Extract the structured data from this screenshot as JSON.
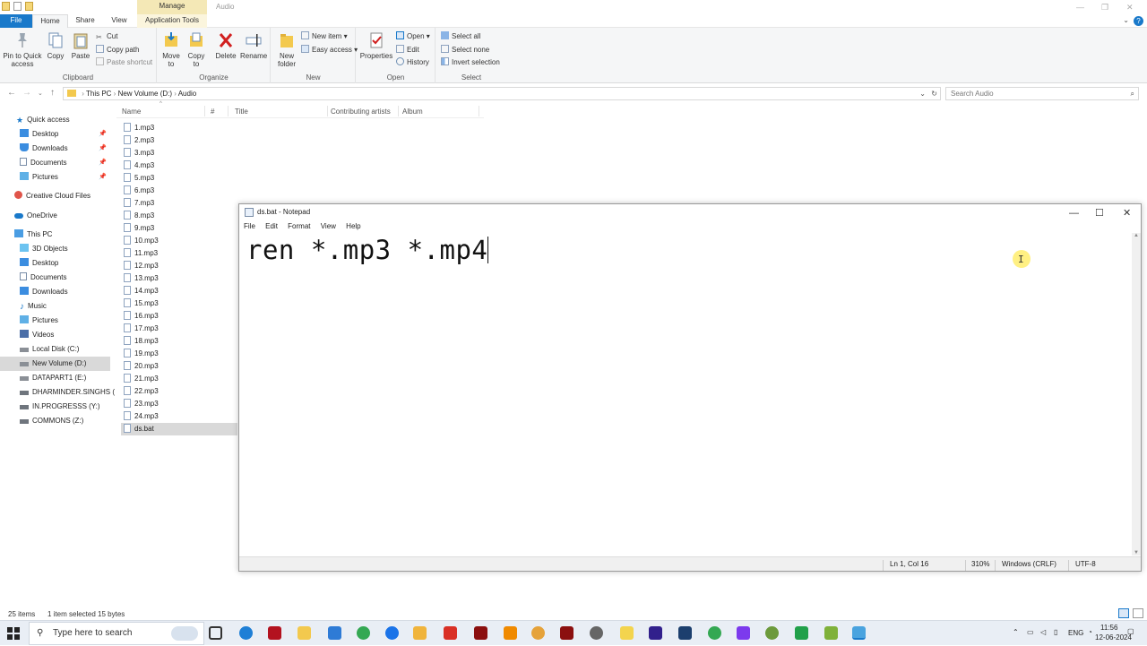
{
  "explorer": {
    "title": "Audio",
    "context_tab": "Manage",
    "tabs": [
      "File",
      "Home",
      "Share",
      "View",
      "Application Tools"
    ],
    "clipboard": {
      "pin": "Pin to Quick access",
      "copy": "Copy",
      "paste": "Paste",
      "cut": "Cut",
      "copy_path": "Copy path",
      "paste_shortcut": "Paste shortcut",
      "label": "Clipboard"
    },
    "organize": {
      "move_to": "Move to",
      "copy_to": "Copy to",
      "delete": "Delete",
      "rename": "Rename",
      "label": "Organize"
    },
    "new": {
      "new_folder": "New folder",
      "new_item": "New item",
      "easy_access": "Easy access",
      "label": "New"
    },
    "open": {
      "properties": "Properties",
      "open": "Open",
      "edit": "Edit",
      "history": "History",
      "label": "Open"
    },
    "select": {
      "select_all": "Select all",
      "select_none": "Select none",
      "invert": "Invert selection",
      "label": "Select"
    },
    "breadcrumb": [
      "This PC",
      "New Volume (D:)",
      "Audio"
    ],
    "search_placeholder": "Search Audio",
    "columns": [
      "Name",
      "#",
      "Title",
      "Contributing artists",
      "Album"
    ],
    "nav": {
      "quick_access": "Quick access",
      "quick": [
        "Desktop",
        "Downloads",
        "Documents",
        "Pictures"
      ],
      "creative_cloud": "Creative Cloud Files",
      "onedrive": "OneDrive",
      "this_pc": "This PC",
      "pc_items": [
        "3D Objects",
        "Desktop",
        "Documents",
        "Downloads",
        "Music",
        "Pictures",
        "Videos",
        "Local Disk (C:)",
        "New Volume (D:)",
        "DATAPART1 (E:)",
        "DHARMINDER.SINGHS (",
        "IN.PROGRESSS (Y:)",
        "COMMONS (Z:)"
      ]
    },
    "files": [
      "1.mp3",
      "2.mp3",
      "3.mp3",
      "4.mp3",
      "5.mp3",
      "6.mp3",
      "7.mp3",
      "8.mp3",
      "9.mp3",
      "10.mp3",
      "11.mp3",
      "12.mp3",
      "13.mp3",
      "14.mp3",
      "15.mp3",
      "16.mp3",
      "17.mp3",
      "18.mp3",
      "19.mp3",
      "20.mp3",
      "21.mp3",
      "22.mp3",
      "23.mp3",
      "24.mp3",
      "ds.bat"
    ],
    "status": {
      "items": "25 items",
      "selected": "1 item selected  15 bytes"
    }
  },
  "notepad": {
    "title": "ds.bat - Notepad",
    "menu": [
      "File",
      "Edit",
      "Format",
      "View",
      "Help"
    ],
    "content": "ren *.mp3 *.mp4",
    "status": {
      "position": "Ln 1, Col 16",
      "zoom": "310%",
      "eol": "Windows (CRLF)",
      "encoding": "UTF-8"
    }
  },
  "taskbar": {
    "search_placeholder": "Type here to search",
    "lang": "ENG",
    "time": "11:56",
    "date": "12-06-2024"
  },
  "colors": {
    "accent": "#1979ca",
    "selection": "#d9d9d9",
    "taskbar": "#e9eef5"
  }
}
